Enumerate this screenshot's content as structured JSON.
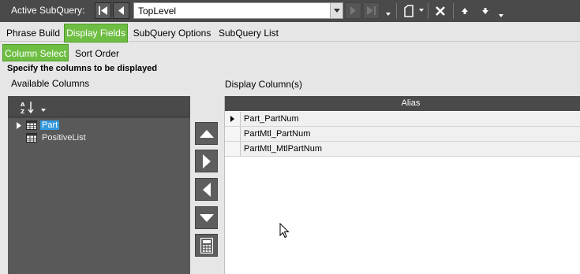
{
  "toolbar": {
    "active_subquery_label": "Active SubQuery:",
    "subquery_value": "TopLevel",
    "buttons": [
      "first-icon",
      "prev-icon",
      "next-icon",
      "last-icon",
      "new-icon",
      "delete-icon",
      "move-up-icon",
      "move-down-icon"
    ]
  },
  "tabs": [
    {
      "label": "Phrase Build",
      "active": false
    },
    {
      "label": "Display Fields",
      "active": true
    },
    {
      "label": "SubQuery Options",
      "active": false
    },
    {
      "label": "SubQuery List",
      "active": false
    }
  ],
  "subtabs": [
    {
      "label": "Column Select",
      "active": true
    },
    {
      "label": "Sort Order",
      "active": false
    }
  ],
  "instructions": "Specify the columns to be displayed",
  "available": {
    "title": "Available Columns",
    "items": [
      {
        "label": "Part",
        "selected": true,
        "expandable": true
      },
      {
        "label": "PositiveList",
        "selected": false,
        "expandable": false
      }
    ]
  },
  "display": {
    "title": "Display Column(s)",
    "header": "Alias",
    "rows": [
      "Part_PartNum",
      "PartMtl_PartNum",
      "PartMtl_MtlPartNum"
    ]
  },
  "colors": {
    "active_tab": "#6fbe44",
    "dark_panel": "#4a4a4a",
    "selection": "#3399dd"
  }
}
